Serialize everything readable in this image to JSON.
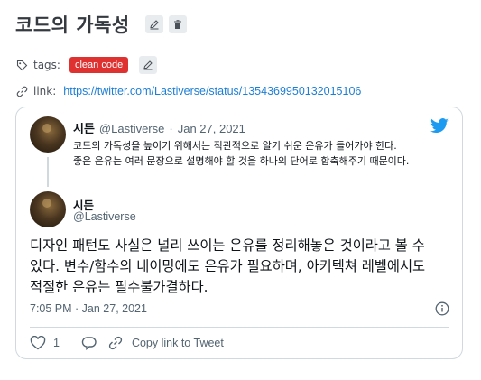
{
  "page": {
    "title": "코드의 가독성",
    "tags_label": "tags:",
    "tag": "clean code",
    "link_label": "link:",
    "link_url": "https://twitter.com/Lastiverse/status/1354369950132015106"
  },
  "quoted_tweet": {
    "name": "시든",
    "handle": "@Lastiverse",
    "separator": "·",
    "date": "Jan 27, 2021",
    "text_line1": "코드의 가독성을 높이기 위해서는 직관적으로 알기 쉬운 은유가 들어가야 한다.",
    "text_line2": "좋은 은유는 여러 문장으로 설명해야 할 것을 하나의 단어로 함축해주기 때문이다."
  },
  "main_tweet": {
    "name": "시든",
    "handle": "@Lastiverse",
    "text_line1": "디자인 패턴도 사실은 널리 쓰이는 은유를 정리해놓은  것이라고 볼 수",
    "text_line2": "있다. 변수/함수의 네이밍에도 은유가 필요하며, 아키텍쳐 레벨에서도",
    "text_line3": "적절한 은유는 필수불가결하다.",
    "timestamp": "7:05 PM · Jan 27, 2021",
    "like_count": "1",
    "copy_link_label": "Copy link to Tweet"
  },
  "colors": {
    "tag_badge": "#e03131",
    "link": "#1c7ed6",
    "twitter_blue": "#1d9bf0"
  },
  "icons": [
    "edit-icon",
    "trash-icon",
    "tag-icon",
    "link-icon",
    "twitter-bird-icon",
    "info-icon",
    "heart-icon",
    "reply-icon",
    "share-link-icon"
  ]
}
